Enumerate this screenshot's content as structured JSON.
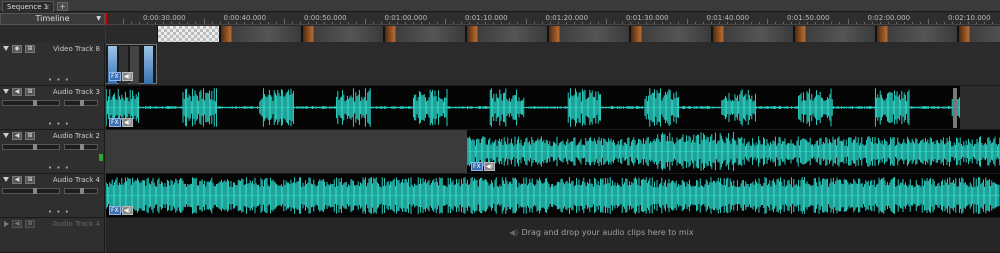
{
  "tabs": [
    {
      "label": "Sequence 1",
      "close": "×"
    }
  ],
  "tab_add": "+",
  "timeline_label": "Timeline",
  "ruler_ticks": [
    "0:00:30.000",
    "0:00:40.000",
    "0:00:50.000",
    "0:01:00.000",
    "0:01:10.000",
    "0:01:20.000",
    "0:01:30.000",
    "0:01:40.000",
    "0:01:50.000",
    "0:02:00.000",
    "0:02:10.000"
  ],
  "tracks": {
    "video8": {
      "name": "Video Track 8"
    },
    "audio3": {
      "name": "Audio Track 3"
    },
    "audio2": {
      "name": "Audio Track 2"
    },
    "audio4": {
      "name": "Audio Track 4"
    },
    "audio4_empty": {
      "name": "Audio Track 4"
    }
  },
  "clip_badges": {
    "fx": "FX",
    "speaker": "◀)"
  },
  "dots": "• • •",
  "drop_hint": "Drag and drop your audio clips here to mix",
  "colors": {
    "waveform": "#2ee6d8",
    "playhead": "#d40000",
    "fx_badge": "#3d6fb3",
    "level": "#2fa52f"
  },
  "icons": [
    "expand-triangle-icon",
    "eye-icon",
    "link-icon",
    "speaker-icon",
    "fx-icon"
  ]
}
